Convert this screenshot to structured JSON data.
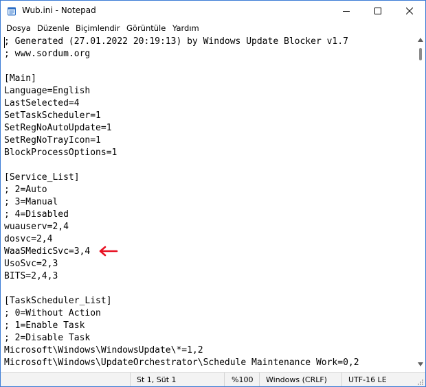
{
  "window": {
    "title": "Wub.ini - Notepad",
    "icon": "notepad-icon",
    "controls": [
      "minimize-icon",
      "maximize-icon",
      "close-icon"
    ]
  },
  "menu": [
    {
      "label": "Dosya"
    },
    {
      "label": "Düzenle"
    },
    {
      "label": "Biçimlendir"
    },
    {
      "label": "Görüntüle"
    },
    {
      "label": "Yardım"
    }
  ],
  "editor": {
    "lines": [
      "; Generated (27.01.2022 20:19:13) by Windows Update Blocker v1.7",
      "; www.sordum.org",
      "",
      "[Main]",
      "Language=English",
      "LastSelected=4",
      "SetTaskScheduler=1",
      "SetRegNoAutoUpdate=1",
      "SetRegNoTrayIcon=1",
      "BlockProcessOptions=1",
      "",
      "[Service_List]",
      "; 2=Auto",
      "; 3=Manual",
      "; 4=Disabled",
      "wuauserv=2,4",
      "dosvc=2,4",
      "WaaSMedicSvc=3,4",
      "UsoSvc=2,3",
      "BITS=2,4,3",
      "",
      "[TaskScheduler_List]",
      "; 0=Without Action",
      "; 1=Enable Task",
      "; 2=Disable Task",
      "Microsoft\\Windows\\WindowsUpdate\\*=1,2",
      "Microsoft\\Windows\\UpdateOrchestrator\\Schedule Maintenance Work=0,2"
    ],
    "annotation": {
      "icon": "red-arrow-icon",
      "color": "#e81123"
    }
  },
  "status": {
    "position": "St 1, Süt 1",
    "zoom": "%100",
    "line_ending": "Windows (CRLF)",
    "encoding": "UTF-16 LE"
  },
  "colors": {
    "window_border": "#3a7bd5",
    "status_bg": "#f3f3f3",
    "annotation": "#e81123"
  }
}
